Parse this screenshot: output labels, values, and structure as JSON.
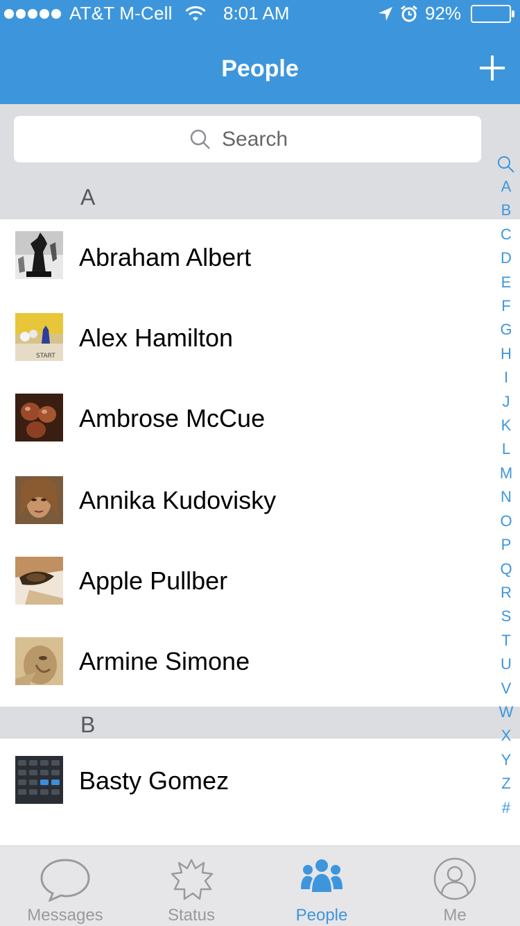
{
  "status_bar": {
    "carrier": "AT&T M-Cell",
    "time": "8:01 AM",
    "battery": "92%",
    "battery_level": 0.92
  },
  "nav": {
    "title": "People",
    "add_icon": "plus-icon"
  },
  "search": {
    "placeholder": "Search"
  },
  "sections": [
    {
      "letter": "A",
      "contacts": [
        {
          "name": "Abraham Albert"
        },
        {
          "name": "Alex Hamilton"
        },
        {
          "name": "Ambrose McCue"
        },
        {
          "name": "Annika Kudovisky"
        },
        {
          "name": "Apple Pullber"
        },
        {
          "name": "Armine Simone"
        }
      ]
    },
    {
      "letter": "B",
      "contacts": [
        {
          "name": "Basty Gomez"
        }
      ]
    }
  ],
  "index": [
    "A",
    "B",
    "C",
    "D",
    "E",
    "F",
    "G",
    "H",
    "I",
    "J",
    "K",
    "L",
    "M",
    "N",
    "O",
    "P",
    "Q",
    "R",
    "S",
    "T",
    "U",
    "V",
    "W",
    "X",
    "Y",
    "Z",
    "#"
  ],
  "tabs": [
    {
      "label": "Messages",
      "icon": "speech-bubble-icon",
      "active": false
    },
    {
      "label": "Status",
      "icon": "starburst-icon",
      "active": false
    },
    {
      "label": "People",
      "icon": "people-group-icon",
      "active": true
    },
    {
      "label": "Me",
      "icon": "person-circle-icon",
      "active": false
    }
  ],
  "colors": {
    "accent": "#3d96dc",
    "section_bg": "#dcdde0",
    "tab_inactive": "#9a9a9c"
  }
}
